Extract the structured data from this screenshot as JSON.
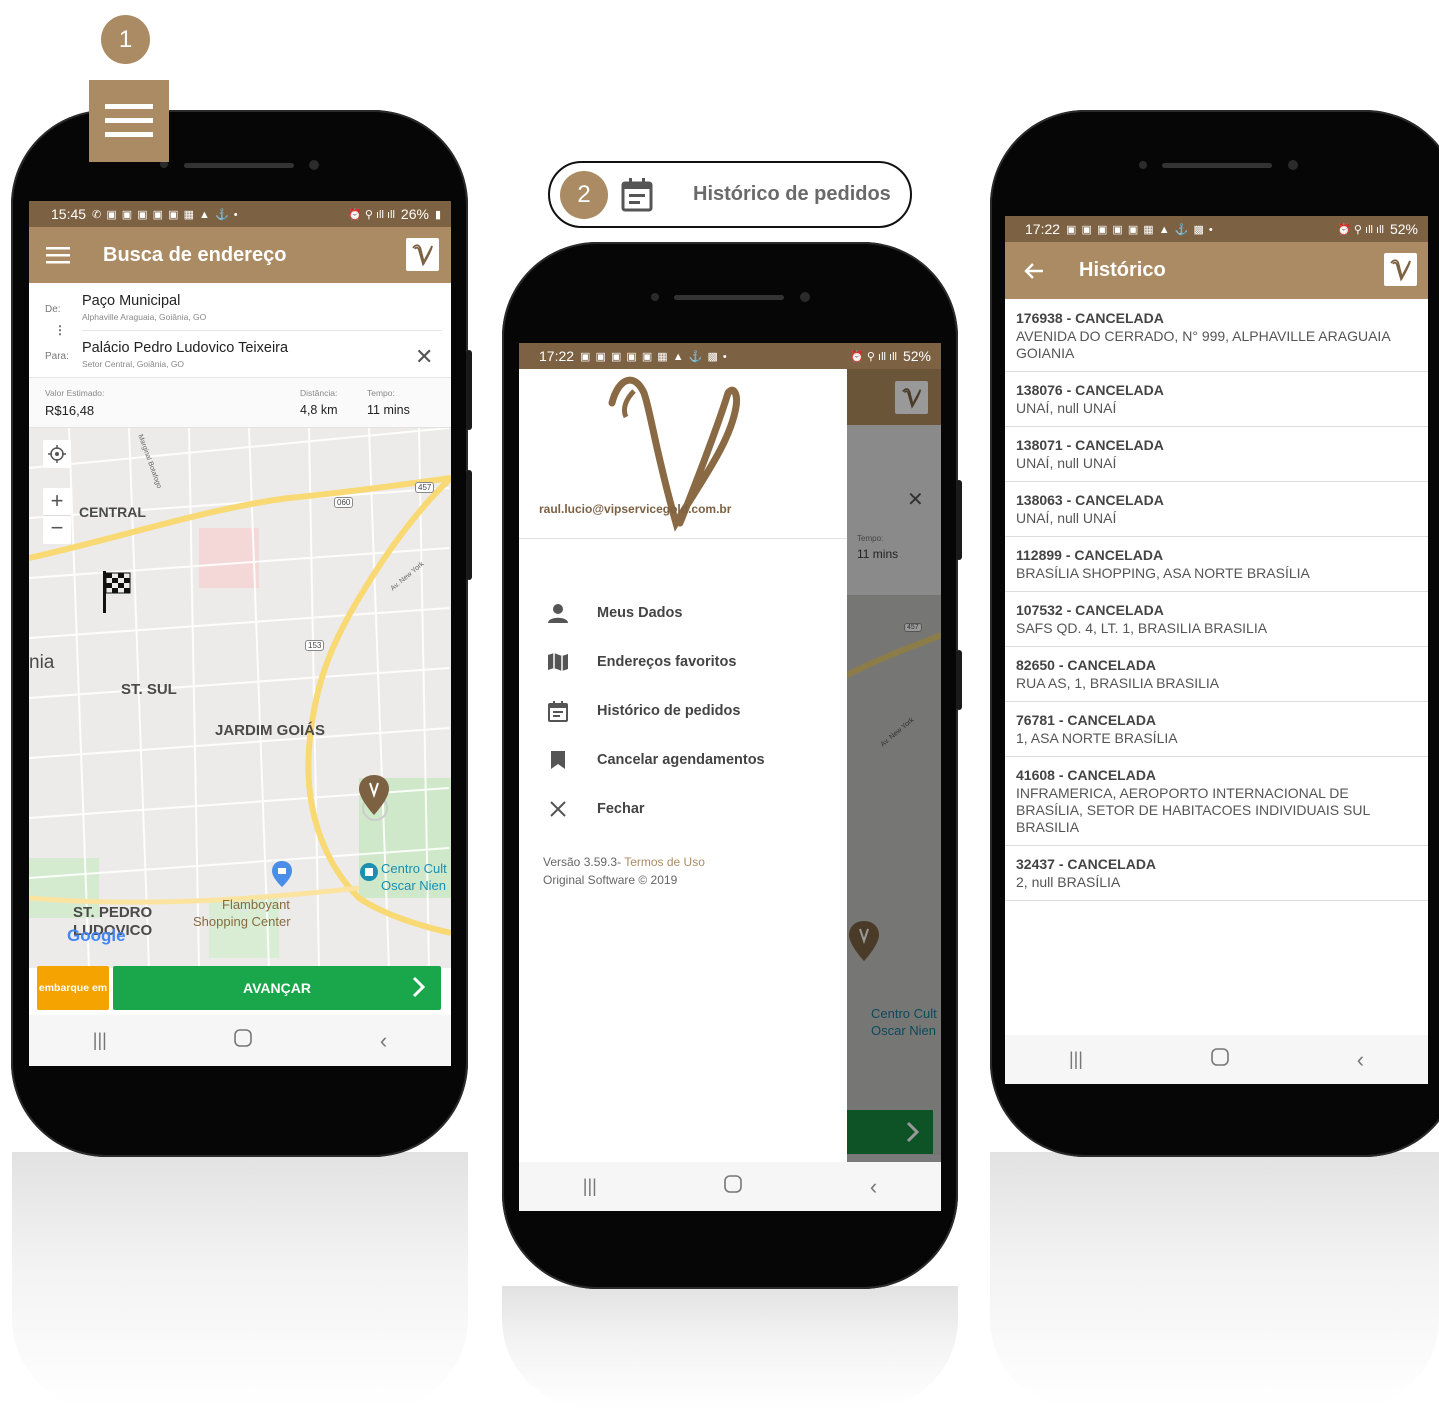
{
  "step1": {
    "badge": "1"
  },
  "step2": {
    "badge": "2",
    "label": "Histórico de pedidos"
  },
  "phone1": {
    "status": {
      "time": "15:45",
      "battery": "26%"
    },
    "appbar": {
      "title": "Busca de endereço"
    },
    "route": {
      "from_label": "De:",
      "from_name": "Paço Municipal",
      "from_address": "Alphaville Araguaia, Goiânia, GO",
      "to_label": "Para:",
      "to_name": "Palácio Pedro Ludovico Teixeira",
      "to_address": "Setor Central, Goiânia, GO"
    },
    "estimate": {
      "value_label": "Valor Estimado:",
      "value": "R$16,48",
      "distance_label": "Distância:",
      "distance": "4,8 km",
      "time_label": "Tempo:",
      "time": "11 mins"
    },
    "map": {
      "labels": {
        "central": "CENTRAL",
        "nia": "nia",
        "st_sul": "ST. SUL",
        "jardim": "JARDIM GOIÁS",
        "st_pedro_1": "ST. PEDRO",
        "st_pedro_2": "LUDOVICO",
        "flamboyant_1": "Flamboyant",
        "flamboyant_2": "Shopping Center",
        "centro_1": "Centro Cult",
        "centro_2": "Oscar Nien",
        "road_457": "457",
        "road_060": "060",
        "road_153": "153",
        "av_new_york": "Av. New York",
        "marginal": "Marginal Botafogo",
        "google": "Google"
      }
    },
    "bottom": {
      "embarque": "embarque em",
      "advance": "AVANÇAR"
    }
  },
  "phone2": {
    "status": {
      "time": "17:22",
      "battery": "52%"
    },
    "drawer": {
      "email": "raul.lucio@vipservicegold.com.br",
      "items": [
        {
          "label": "Meus Dados",
          "icon": "person-icon"
        },
        {
          "label": "Endereços favoritos",
          "icon": "map-icon"
        },
        {
          "label": "Histórico de pedidos",
          "icon": "calendar-icon"
        },
        {
          "label": "Cancelar agendamentos",
          "icon": "bookmark-icon"
        },
        {
          "label": "Fechar",
          "icon": "close-icon"
        }
      ],
      "version": "Versão 3.59.3",
      "terms": "Termos de Uso",
      "copyright": "Original Software © 2019"
    },
    "behind": {
      "time_label": "Tempo:",
      "time": "11 mins",
      "road_457": "457",
      "av_new_york": "Av. New York",
      "centro_1": "Centro Cult",
      "centro_2": "Oscar Nien"
    }
  },
  "phone3": {
    "status": {
      "time": "17:22",
      "battery": "52%"
    },
    "appbar": {
      "title": "Histórico"
    },
    "orders": [
      {
        "title": "176938 - CANCELADA",
        "address": "AVENIDA DO CERRADO, N° 999, ALPHAVILLE ARAGUAIA GOIANIA"
      },
      {
        "title": "138076 - CANCELADA",
        "address": "UNAÍ, null UNAÍ"
      },
      {
        "title": "138071 - CANCELADA",
        "address": "UNAÍ, null UNAÍ"
      },
      {
        "title": "138063 - CANCELADA",
        "address": "UNAÍ, null UNAÍ"
      },
      {
        "title": "112899 - CANCELADA",
        "address": "BRASÍLIA SHOPPING, ASA NORTE BRASÍLIA"
      },
      {
        "title": "107532 - CANCELADA",
        "address": "SAFS QD. 4, LT. 1, BRASILIA BRASILIA"
      },
      {
        "title": "82650 - CANCELADA",
        "address": "RUA AS, 1, BRASILIA BRASILIA"
      },
      {
        "title": "76781 - CANCELADA",
        "address": "1, ASA NORTE BRASÍLIA"
      },
      {
        "title": "41608 - CANCELADA",
        "address": "INFRAMERICA, AEROPORTO INTERNACIONAL DE BRASÍLIA, SETOR DE HABITACOES INDIVIDUAIS SUL BRASILIA"
      },
      {
        "title": "32437 - CANCELADA",
        "address": "2, null BRASÍLIA"
      }
    ]
  },
  "colors": {
    "brand": "#ab8b63",
    "status_bar": "#7d6143",
    "accent_green": "#1aa64a",
    "accent_orange": "#f5a300"
  }
}
